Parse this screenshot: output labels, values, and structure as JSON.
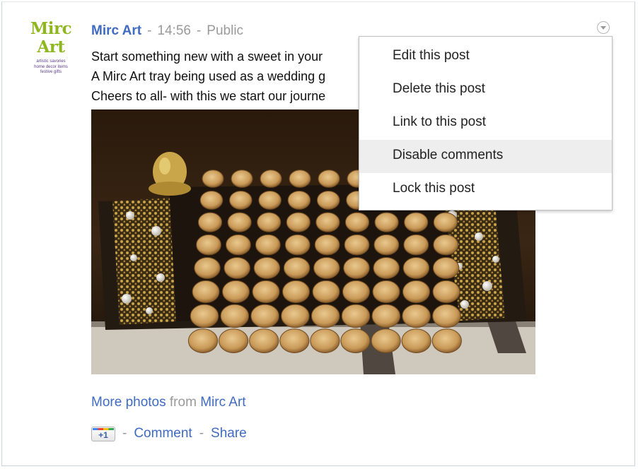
{
  "avatar": {
    "logo_text": "Mirc Art",
    "tagline": [
      "artistic savories",
      "home decor items",
      "festive gifts"
    ]
  },
  "post": {
    "author": "Mirc Art",
    "separator": "-",
    "time": "14:56",
    "visibility": "Public",
    "text_lines": [
      "Start something new with a sweet in your",
      "A Mirc Art tray being used as a wedding g",
      "Cheers to all- with this we start our journe"
    ],
    "photo_icon": "photo-image"
  },
  "more_photos": {
    "link_label": "More photos",
    "from": "from",
    "source": "Mirc Art"
  },
  "actions": {
    "plusone_label": "+1",
    "separator": "-",
    "comment": "Comment",
    "share": "Share"
  },
  "menu": {
    "toggle_icon": "chevron-down-circle-icon",
    "items": [
      {
        "label": "Edit this post"
      },
      {
        "label": "Delete this post"
      },
      {
        "label": "Link to this post"
      },
      {
        "label": "Disable comments",
        "highlighted": true
      },
      {
        "label": "Lock this post"
      }
    ]
  },
  "colors": {
    "link": "#3f6bc1",
    "meta": "#9a9a9a",
    "logo": "#8fb51f",
    "menu_highlight": "#eeeeee"
  }
}
